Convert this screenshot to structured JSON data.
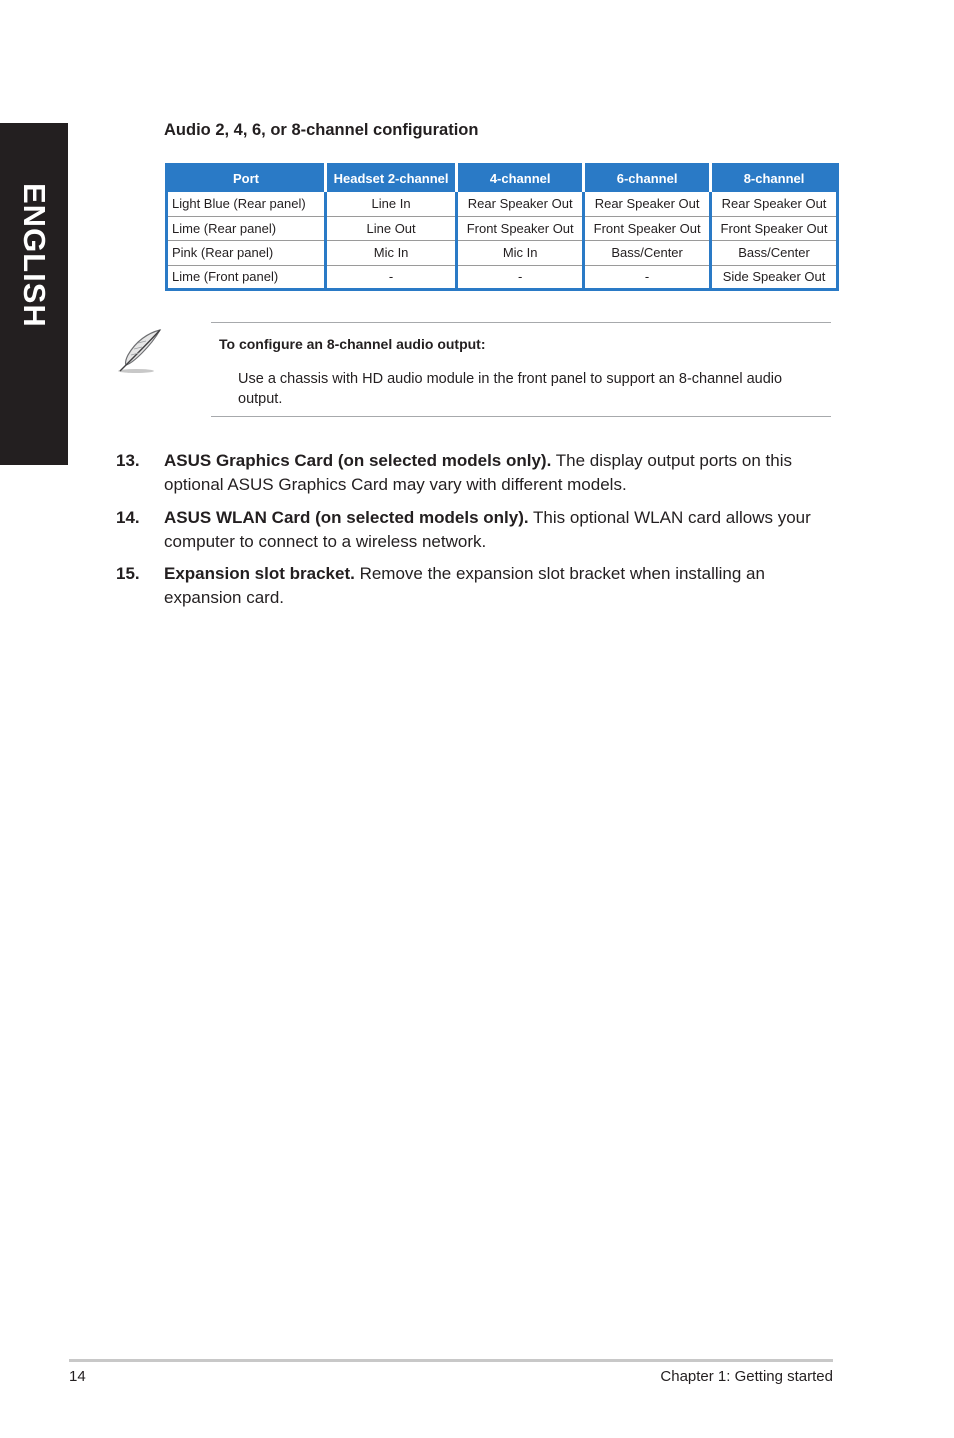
{
  "side_tab": {
    "label": "ENGLISH"
  },
  "section": {
    "title": "Audio 2, 4, 6, or 8-channel configuration"
  },
  "table": {
    "headers": [
      "Port",
      "Headset 2-channel",
      "4-channel",
      "6-channel",
      "8-channel"
    ],
    "rows": [
      [
        "Light Blue (Rear panel)",
        "Line In",
        "Rear Speaker Out",
        "Rear Speaker Out",
        "Rear Speaker Out"
      ],
      [
        "Lime (Rear panel)",
        "Line Out",
        "Front Speaker Out",
        "Front Speaker Out",
        "Front Speaker Out"
      ],
      [
        "Pink (Rear panel)",
        "Mic In",
        "Mic In",
        "Bass/Center",
        "Bass/Center"
      ],
      [
        "Lime (Front panel)",
        "-",
        "-",
        "-",
        "Side Speaker Out"
      ]
    ],
    "colors": {
      "header_bg": "#2a7ac6",
      "header_text": "#ffffff"
    }
  },
  "note": {
    "icon": "feather-pen-icon",
    "title": "To configure an 8-channel audio output:",
    "text": "Use a chassis with HD audio module in the front panel to support an 8-channel audio output."
  },
  "items": [
    {
      "number": "13.",
      "bold": "ASUS Graphics Card (on selected models only).",
      "text": " The display output ports on this optional ASUS Graphics Card may vary with different models."
    },
    {
      "number": "14.",
      "bold": "ASUS WLAN Card (on selected models only).",
      "text": " This optional WLAN card allows your computer to connect to a wireless network."
    },
    {
      "number": "15.",
      "bold": "Expansion slot bracket.",
      "text": " Remove the expansion slot bracket when installing an expansion card."
    }
  ],
  "footer": {
    "page_number": "14",
    "chapter": "Chapter 1: Getting started"
  }
}
